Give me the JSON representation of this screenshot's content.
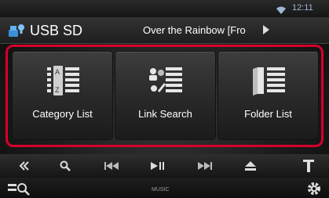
{
  "status_bar": {
    "clock": "12:11",
    "icons": [
      "wifi-icon"
    ]
  },
  "header": {
    "source_icon": "usb-sd-icon",
    "source": "USB SD",
    "track_title": "Over the Rainbow [Fro",
    "more_icon": "play-triangle-icon"
  },
  "tiles": [
    {
      "label": "Category List",
      "icon": "category-list-icon"
    },
    {
      "label": "Link Search",
      "icon": "link-search-icon"
    },
    {
      "label": "Folder List",
      "icon": "folder-list-icon"
    }
  ],
  "controls": {
    "icons": [
      "double-chevron-left-icon",
      "search-icon",
      "skip-back-icon",
      "play-pause-icon",
      "skip-forward-icon",
      "eject-icon",
      "antenna-icon"
    ]
  },
  "bottom_bar": {
    "mode_label": "MUSIC",
    "icons": [
      "list-search-icon",
      "gear-icon"
    ]
  },
  "colors": {
    "highlight": "#d6002a",
    "clock": "#9fb7d6",
    "accent_blue": "#4aa0e0"
  }
}
